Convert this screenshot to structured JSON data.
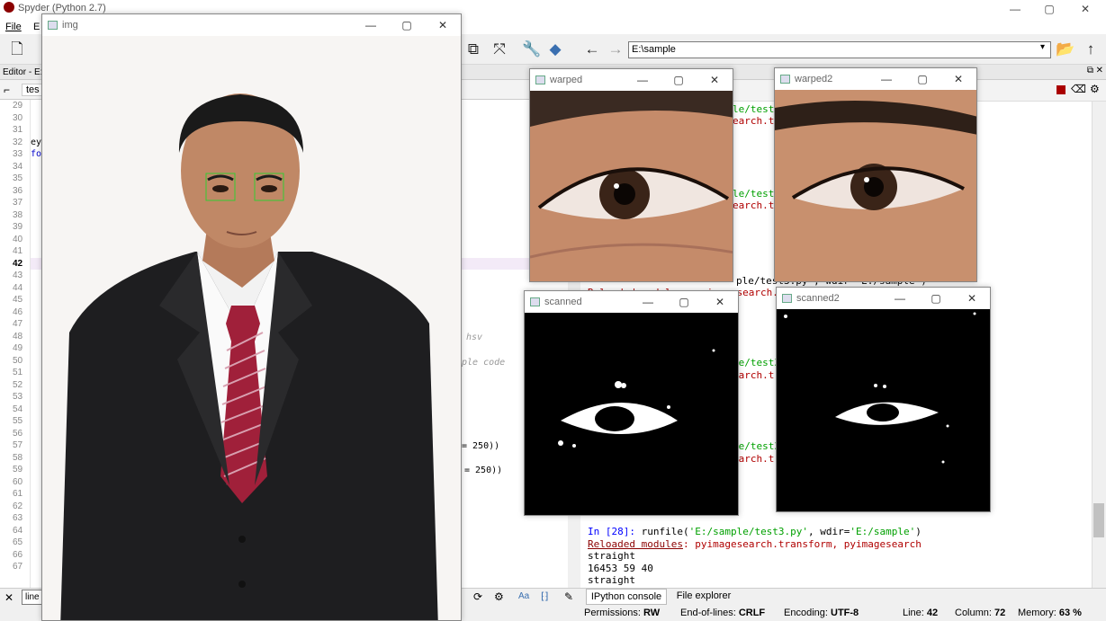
{
  "app": {
    "title": "Spyder (Python 2.7)",
    "menu": [
      "File",
      "E"
    ],
    "path_value": "E:\\sample",
    "window_controls": [
      "—",
      "▢",
      "✕"
    ]
  },
  "editor": {
    "header": "Editor - E:",
    "tab_label": "tes",
    "line_numbers": [
      "29",
      "30",
      "31",
      "32",
      "33",
      "34",
      "35",
      "36",
      "37",
      "38",
      "39",
      "40",
      "41",
      "42",
      "43",
      "44",
      "45",
      "46",
      "47",
      "48",
      "49",
      "50",
      "51",
      "52",
      "53",
      "54",
      "55",
      "56",
      "57",
      "58",
      "59",
      "60",
      "61",
      "62",
      "63",
      "64",
      "65",
      "66",
      "67"
    ],
    "current_line": "42",
    "fragments": {
      "line32": "ey",
      "line33": "fo",
      "hsv": "hsv",
      "sample": "ple code",
      "eq1": "= 250))",
      "eq2": "= 250))"
    },
    "find_value": "line"
  },
  "console": {
    "lines": [
      {
        "kind": "frag1",
        "text": "le/test3"
      },
      {
        "kind": "frag2",
        "text": "earch.t"
      },
      {
        "kind": "frag1",
        "text": "le/test3"
      },
      {
        "kind": "frag2",
        "text": "earch.t"
      },
      {
        "kind": "frag3",
        "text": "ple/test3.py', wdir='E:/sample')"
      },
      {
        "kind": "frag4",
        "text": "Reloaded modules: pyimagesearch.t"
      },
      {
        "kind": "frag1",
        "text": "le/test3"
      },
      {
        "kind": "frag2",
        "text": "earch.t"
      },
      {
        "kind": "frag1",
        "text": "le/test3"
      },
      {
        "kind": "frag2",
        "text": "earch.t"
      }
    ],
    "prompt_in": "In [28]:",
    "prompt_cmd": "runfile(",
    "prompt_arg1": "'E:/sample/test3.py'",
    "prompt_mid": ", wdir=",
    "prompt_arg2": "'E:/sample'",
    "prompt_end": ")",
    "reloaded_label": "Reloaded modules",
    "reloaded_rest": ": pyimagesearch.transform, pyimagesearch",
    "out1": "straight",
    "out2": "16453 59 40",
    "out3": "straight",
    "tabs": [
      "IPython console",
      "File explorer"
    ]
  },
  "status": {
    "permissions_label": "Permissions:",
    "permissions_value": "RW",
    "eol_label": "End-of-lines:",
    "eol_value": "CRLF",
    "encoding_label": "Encoding:",
    "encoding_value": "UTF-8",
    "line_label": "Line:",
    "line_value": "42",
    "column_label": "Column:",
    "column_value": "72",
    "memory_label": "Memory:",
    "memory_value": "63 %"
  },
  "windows": {
    "img": "img",
    "warped": "warped",
    "warped2": "warped2",
    "scanned": "scanned",
    "scanned2": "scanned2"
  },
  "colors": {
    "prompt_blue": "#0000ff",
    "string_green": "#00a000",
    "reload_red": "#8b0000"
  }
}
